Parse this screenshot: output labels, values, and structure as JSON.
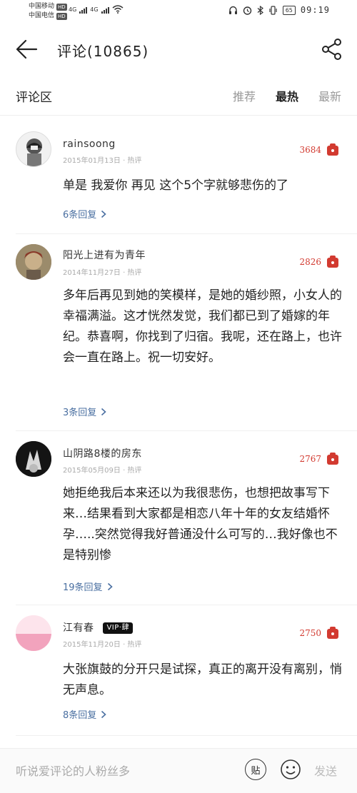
{
  "status_bar": {
    "carrier1": "中国移动",
    "carrier2": "中国电信",
    "hd": "HD",
    "net1": "4G",
    "net2": "4G",
    "battery": "65",
    "time": "09:19"
  },
  "header": {
    "title": "评论(10865)"
  },
  "section": {
    "title": "评论区",
    "tabs": [
      "推荐",
      "最热",
      "最新"
    ],
    "active_tab": "最热"
  },
  "comments": [
    {
      "username": "rainsoong",
      "meta": "2015年01月13日 · 热评",
      "likes": "3684",
      "content": "单是 我爱你 再见 这个5个字就够悲伤的了",
      "replies": "6条回复"
    },
    {
      "username": "阳光上进有为青年",
      "meta": "2014年11月27日 · 热评",
      "likes": "2826",
      "content": "多年后再见到她的笑模样，是她的婚纱照，小女人的幸福满溢。这才恍然发觉，我们都已到了婚嫁的年纪。恭喜啊，你找到了归宿。我呢，还在路上，也许会一直在路上。祝一切安好。",
      "replies": "3条回复"
    },
    {
      "username": "山阴路8楼的房东",
      "meta": "2015年05月09日 · 热评",
      "likes": "2767",
      "content": "她拒绝我后本来还以为我很悲伤，也想把故事写下来…结果看到大家都是相恋八年十年的女友结婚怀孕…..突然觉得我好普通没什么可写的…我好像也不是特别惨",
      "replies": "19条回复"
    },
    {
      "username": "江有春",
      "vip": "VIP·肆",
      "meta": "2015年11月20日 · 热评",
      "likes": "2750",
      "content": "大张旗鼓的分开只是试探，真正的离开没有离别，悄无声息。",
      "replies": "8条回复"
    }
  ],
  "bottom_bar": {
    "placeholder": "听说爱评论的人粉丝多",
    "sticker": "贴",
    "send": "发送"
  },
  "colors": {
    "like_red": "#d23a30",
    "reply_blue": "#4a6fa1"
  },
  "icons": [
    "back-arrow-icon",
    "share-icon",
    "like-icon",
    "emoji-icon",
    "chevron-right-icon"
  ]
}
